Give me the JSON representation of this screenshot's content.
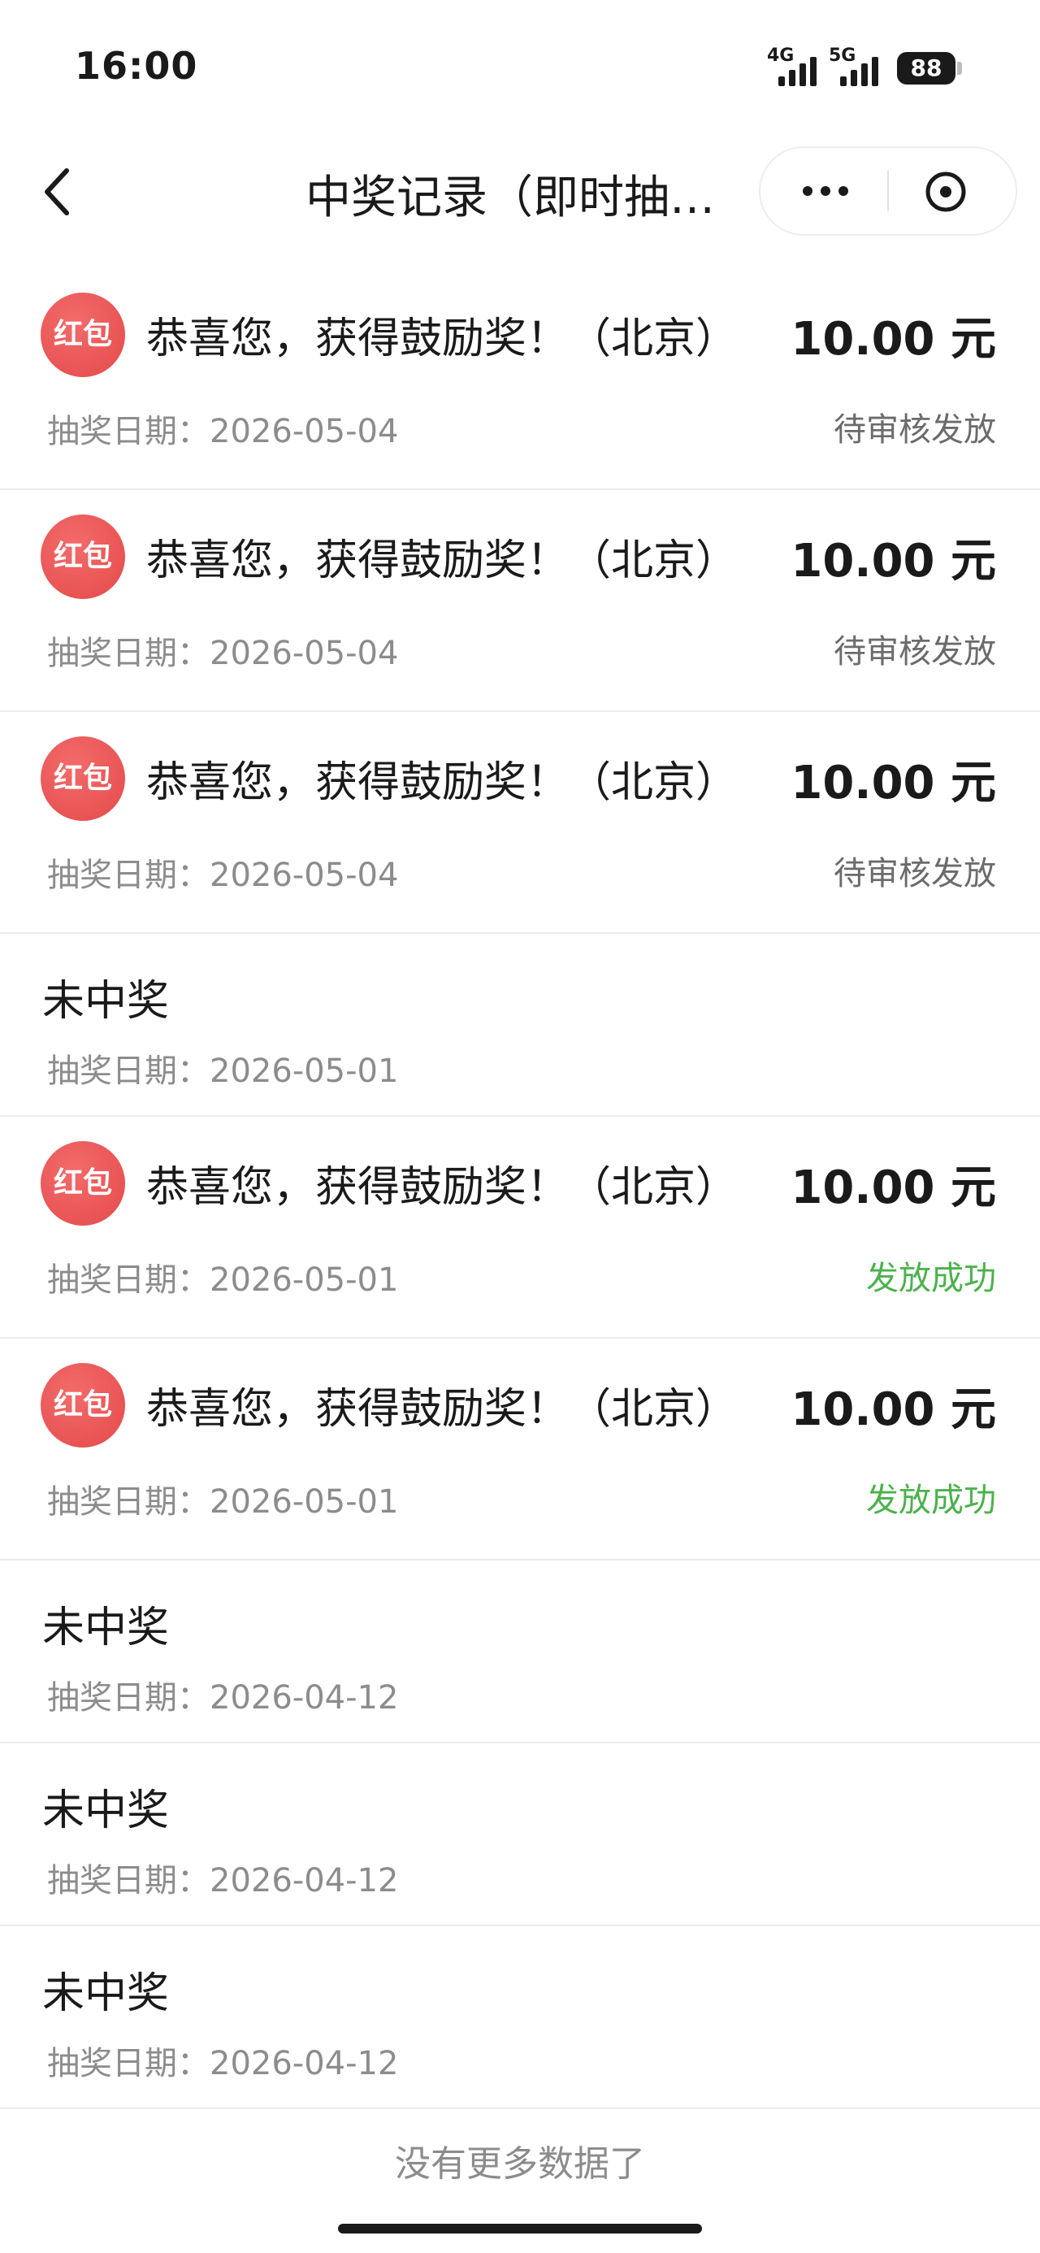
{
  "status_bar": {
    "time": "16:00",
    "net1": "4G",
    "net2": "5G",
    "battery": "88"
  },
  "nav": {
    "title": "中奖记录（即时抽…"
  },
  "records": [
    {
      "type": "prize",
      "badge": "红包",
      "text": "恭喜您，获得鼓励奖！（北京）",
      "amount": "10.00 元",
      "date": "抽奖日期：2026-05-04",
      "status": "待审核发放",
      "status_kind": "pending"
    },
    {
      "type": "prize",
      "badge": "红包",
      "text": "恭喜您，获得鼓励奖！（北京）",
      "amount": "10.00 元",
      "date": "抽奖日期：2026-05-04",
      "status": "待审核发放",
      "status_kind": "pending"
    },
    {
      "type": "prize",
      "badge": "红包",
      "text": "恭喜您，获得鼓励奖！（北京）",
      "amount": "10.00 元",
      "date": "抽奖日期：2026-05-04",
      "status": "待审核发放",
      "status_kind": "pending"
    },
    {
      "type": "noprize",
      "text": "未中奖",
      "date": "抽奖日期：2026-05-01"
    },
    {
      "type": "prize",
      "badge": "红包",
      "text": "恭喜您，获得鼓励奖！（北京）",
      "amount": "10.00 元",
      "date": "抽奖日期：2026-05-01",
      "status": "发放成功",
      "status_kind": "success"
    },
    {
      "type": "prize",
      "badge": "红包",
      "text": "恭喜您，获得鼓励奖！（北京）",
      "amount": "10.00 元",
      "date": "抽奖日期：2026-05-01",
      "status": "发放成功",
      "status_kind": "success"
    },
    {
      "type": "noprize",
      "text": "未中奖",
      "date": "抽奖日期：2026-04-12"
    },
    {
      "type": "noprize",
      "text": "未中奖",
      "date": "抽奖日期：2026-04-12"
    },
    {
      "type": "noprize",
      "text": "未中奖",
      "date": "抽奖日期：2026-04-12"
    }
  ],
  "footer": {
    "message": "没有更多数据了"
  },
  "colors": {
    "badge": "#e85050",
    "success": "#4cb14c",
    "muted": "#8c8c8c"
  },
  "icons": {
    "back": "chevron-left-icon",
    "more": "more-dots-icon",
    "close": "close-circle-icon"
  }
}
